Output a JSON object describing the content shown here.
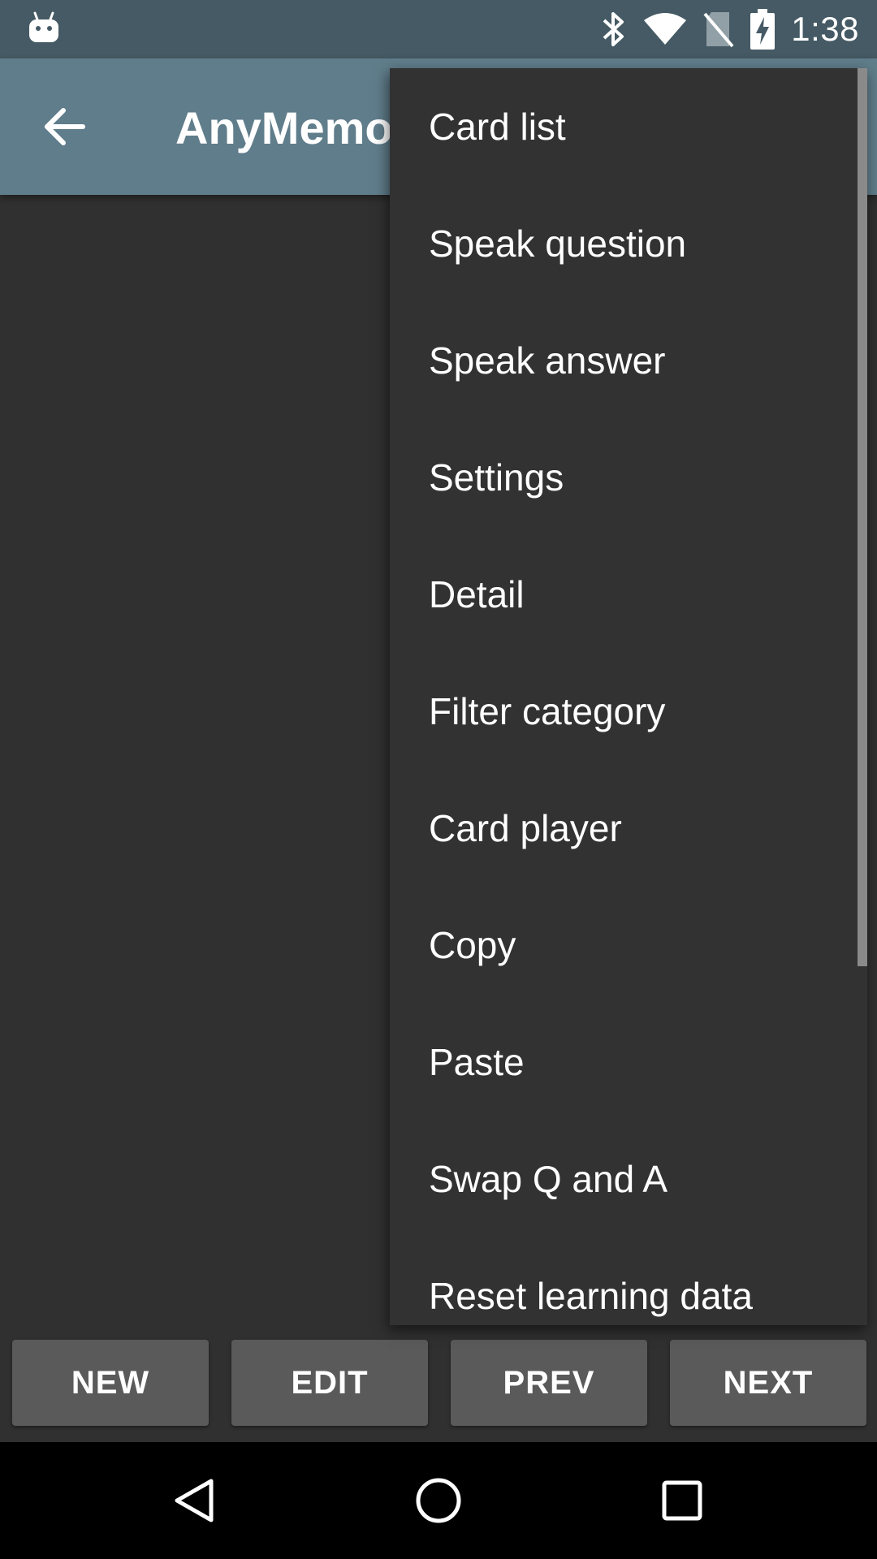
{
  "status_bar": {
    "time": "1:38",
    "icons": [
      "android-debug-icon",
      "bluetooth-icon",
      "wifi-icon",
      "no-sim-icon",
      "battery-charging-icon"
    ]
  },
  "app_bar": {
    "title": "AnyMemo",
    "back_icon": "arrow-back-icon"
  },
  "overflow_menu": {
    "items": [
      {
        "label": "Card list"
      },
      {
        "label": "Speak question"
      },
      {
        "label": "Speak answer"
      },
      {
        "label": "Settings"
      },
      {
        "label": "Detail"
      },
      {
        "label": "Filter category"
      },
      {
        "label": "Card player"
      },
      {
        "label": "Copy"
      },
      {
        "label": "Paste"
      },
      {
        "label": "Swap Q and A"
      },
      {
        "label": "Reset learning data"
      }
    ]
  },
  "bottom_buttons": {
    "new_label": "NEW",
    "edit_label": "EDIT",
    "prev_label": "PREV",
    "next_label": "NEXT"
  },
  "nav_bar": {
    "icons": [
      "back-triangle-icon",
      "home-circle-icon",
      "recents-square-icon"
    ]
  },
  "colors": {
    "status_bar": "#455a64",
    "app_bar": "#607d8b",
    "background": "#303030",
    "menu": "#323232",
    "button": "#5a5a5a"
  }
}
